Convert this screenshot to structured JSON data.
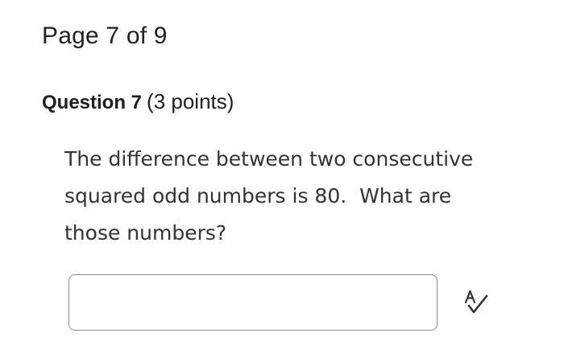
{
  "page_indicator": "Page 7 of 9",
  "question": {
    "title": "Question 7",
    "points": "(3 points)",
    "text": "The difference between two consecutive\nsquared odd numbers is 80.  What are\nthose numbers?"
  },
  "answer": {
    "value": "",
    "placeholder": ""
  },
  "icons": {
    "spellcheck": "spellcheck-icon"
  }
}
